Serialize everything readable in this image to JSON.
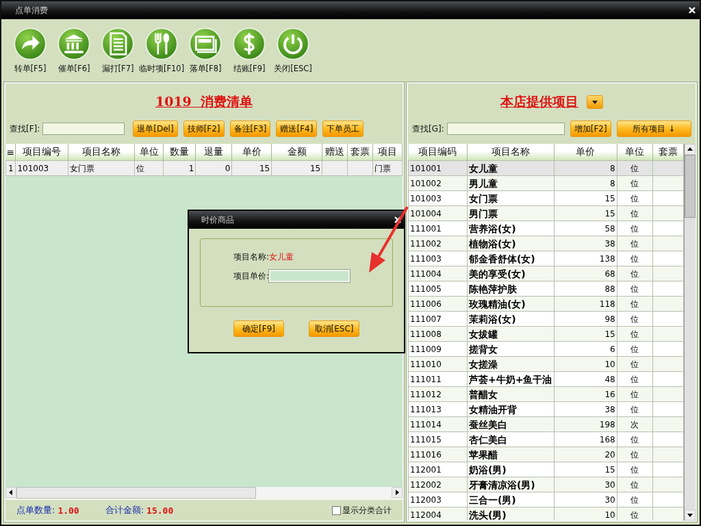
{
  "window": {
    "title": "点单消费"
  },
  "toolbar": [
    {
      "label": "转单[F5]"
    },
    {
      "label": "催单[F6]"
    },
    {
      "label": "漏打[F7]"
    },
    {
      "label": "临时项[F10]"
    },
    {
      "label": "落单[F8]"
    },
    {
      "label": "结账[F9]"
    },
    {
      "label": "关闭[ESC]"
    }
  ],
  "order_panel": {
    "title": "1019  消费清单",
    "search_label": "查找[F]:",
    "buttons": [
      "退单[Del]",
      "技师[F2]",
      "备注[F3]",
      "赠送[F4]",
      "下单员工"
    ],
    "columns": [
      "≡",
      "项目编号",
      "项目名称",
      "单位",
      "数量",
      "退量",
      "单价",
      "金额",
      "赠送",
      "套票",
      "项目"
    ],
    "rows": [
      [
        "1",
        "101003",
        "女门票",
        "位",
        "1",
        "0",
        "15",
        "15",
        "",
        "",
        "门票"
      ]
    ],
    "footer": {
      "count_label": "点单数量:",
      "count": "1.00",
      "total_label": "合计金额:",
      "total": "15.00",
      "show_category": {
        "label": "显示分类合计",
        "checked": false
      }
    }
  },
  "items_panel": {
    "title": "本店提供项目",
    "search_label": "查找[G]:",
    "buttons": [
      "增加[F2]",
      "所有项目 ↓"
    ],
    "columns": [
      "项目编码",
      "项目名称",
      "单价",
      "单位",
      "套票"
    ],
    "rows": [
      {
        "code": "101001",
        "name": "女儿童",
        "price": "8",
        "unit": "位",
        "selected": true
      },
      {
        "code": "101002",
        "name": "男儿童",
        "price": "8",
        "unit": "位",
        "selected": false
      },
      {
        "code": "101003",
        "name": "女门票",
        "price": "15",
        "unit": "位",
        "selected": false
      },
      {
        "code": "101004",
        "name": "男门票",
        "price": "15",
        "unit": "位",
        "selected": false
      },
      {
        "code": "111001",
        "name": "营养浴(女)",
        "price": "58",
        "unit": "位",
        "selected": false
      },
      {
        "code": "111002",
        "name": "植物浴(女)",
        "price": "38",
        "unit": "位",
        "selected": false
      },
      {
        "code": "111003",
        "name": "郁金香舒体(女)",
        "price": "138",
        "unit": "位",
        "selected": false
      },
      {
        "code": "111004",
        "name": "美的享受(女)",
        "price": "68",
        "unit": "位",
        "selected": false
      },
      {
        "code": "111005",
        "name": "陈艳萍护肤",
        "price": "88",
        "unit": "位",
        "selected": false
      },
      {
        "code": "111006",
        "name": "玫瑰精油(女)",
        "price": "118",
        "unit": "位",
        "selected": false
      },
      {
        "code": "111007",
        "name": "茉莉浴(女)",
        "price": "98",
        "unit": "位",
        "selected": false
      },
      {
        "code": "111008",
        "name": "女拔罐",
        "price": "15",
        "unit": "位",
        "selected": false
      },
      {
        "code": "111009",
        "name": "搓背女",
        "price": "6",
        "unit": "位",
        "selected": false
      },
      {
        "code": "111010",
        "name": "女搓澡",
        "price": "10",
        "unit": "位",
        "selected": false
      },
      {
        "code": "111011",
        "name": "芦荟+牛奶+鱼干油",
        "price": "48",
        "unit": "位",
        "selected": false
      },
      {
        "code": "111012",
        "name": "普醋女",
        "price": "16",
        "unit": "位",
        "selected": false
      },
      {
        "code": "111013",
        "name": "女精油开背",
        "price": "38",
        "unit": "位",
        "selected": false
      },
      {
        "code": "111014",
        "name": "蚕丝美白",
        "price": "198",
        "unit": "次",
        "selected": false
      },
      {
        "code": "111015",
        "name": "杏仁美白",
        "price": "168",
        "unit": "位",
        "selected": false
      },
      {
        "code": "111016",
        "name": "苹果醋",
        "price": "20",
        "unit": "位",
        "selected": false
      },
      {
        "code": "112001",
        "name": "奶浴(男)",
        "price": "15",
        "unit": "位",
        "selected": false
      },
      {
        "code": "112002",
        "name": "牙膏清凉浴(男)",
        "price": "30",
        "unit": "位",
        "selected": false
      },
      {
        "code": "112003",
        "name": "三合一(男)",
        "price": "30",
        "unit": "位",
        "selected": false
      },
      {
        "code": "112004",
        "name": "洗头(男)",
        "price": "10",
        "unit": "位",
        "selected": false
      }
    ]
  },
  "dialog": {
    "title": "时价商品",
    "name_label": "项目名称:",
    "name_value": "女儿童",
    "price_label": "项目单价:",
    "buttons": [
      "确定[F9]",
      "取消[ESC]"
    ]
  }
}
